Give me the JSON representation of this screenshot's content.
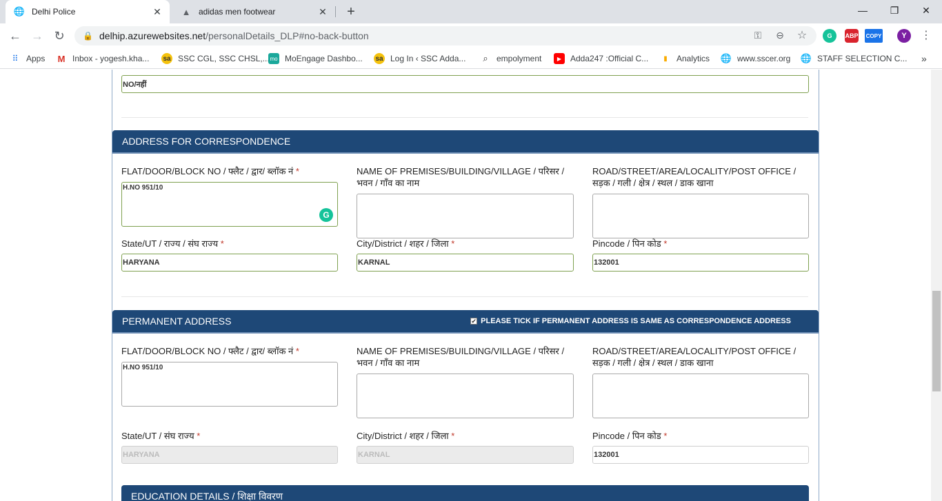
{
  "browser": {
    "tabs": [
      {
        "title": "Delhi Police",
        "active": true,
        "icon": "globe-icon"
      },
      {
        "title": "adidas men footwear",
        "active": false,
        "icon": "adidas-icon"
      }
    ],
    "url_host": "delhip.azurewebsites.net",
    "url_path": "/personalDetails_DLP#no-back-button",
    "profile_initial": "Y",
    "ext_copy_label": "COPY",
    "ext_abp_label": "ABP",
    "ext_g_label": "G"
  },
  "bookmarks": [
    {
      "label": "Apps",
      "icon": "apps-grid-icon"
    },
    {
      "label": "Inbox - yogesh.kha...",
      "icon": "gmail-icon"
    },
    {
      "label": "SSC CGL, SSC CHSL,...",
      "icon": "sa-icon"
    },
    {
      "label": "MoEngage Dashbo...",
      "icon": "moengage-icon"
    },
    {
      "label": "Log In ‹ SSC Adda...",
      "icon": "sa-icon"
    },
    {
      "label": "empolyment",
      "icon": "search-icon"
    },
    {
      "label": "Adda247 :Official C...",
      "icon": "youtube-icon"
    },
    {
      "label": "Analytics",
      "icon": "analytics-icon"
    },
    {
      "label": "www.sscer.org",
      "icon": "globe-icon"
    },
    {
      "label": "STAFF SELECTION C...",
      "icon": "globe-icon"
    }
  ],
  "form": {
    "top_field_value": "NO/नहीं",
    "correspondence": {
      "heading": "ADDRESS FOR CORRESPONDENCE",
      "flat_label": "FLAT/DOOR/BLOCK NO / फ्लैट / द्वार/ ब्लॉक नं",
      "flat_value": "H.NO 951/10",
      "premises_label_1": "NAME OF PREMISES/BUILDING/VILLAGE / परिसर /",
      "premises_label_2": "भवन / गाँव का नाम",
      "premises_value": "",
      "road_label_1": "ROAD/STREET/AREA/LOCALITY/POST OFFICE /",
      "road_label_2": "सड़क / गली / क्षेत्र / स्थल / डाक खाना",
      "road_value": "",
      "state_label": "State/UT / राज्य / संघ राज्य",
      "state_value": "HARYANA",
      "city_label": "City/District / शहर / जिला",
      "city_value": "KARNAL",
      "pincode_label": "Pincode / पिन कोड",
      "pincode_value": "132001"
    },
    "permanent": {
      "heading": "PERMANENT ADDRESS",
      "same_checkbox_label": "PLEASE TICK IF PERMANENT ADDRESS IS SAME AS CORRESPONDENCE ADDRESS",
      "same_checked": "✔",
      "flat_label": "FLAT/DOOR/BLOCK NO / फ्लैट / द्वार/ ब्लॉक नं",
      "flat_value": "H.NO 951/10",
      "premises_label_1": "NAME OF PREMISES/BUILDING/VILLAGE / परिसर /",
      "premises_label_2": "भवन / गाँव का नाम",
      "premises_value": "",
      "road_label_1": "ROAD/STREET/AREA/LOCALITY/POST OFFICE /",
      "road_label_2": "सड़क / गली / क्षेत्र / स्थल / डाक खाना",
      "road_value": "",
      "state_label": "State/UT / संघ राज्य",
      "state_value": "HARYANA",
      "city_label": "City/District / शहर / जिला",
      "city_value": "KARNAL",
      "pincode_label": "Pincode / पिन कोड",
      "pincode_value": "132001"
    },
    "education_heading": "EDUCATION DETAILS / शिक्षा विवरण",
    "required_mark": "*"
  }
}
